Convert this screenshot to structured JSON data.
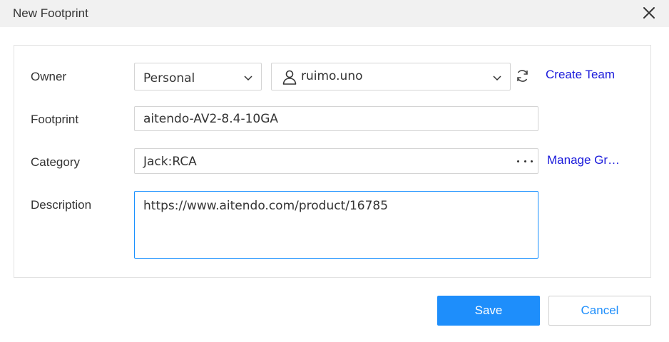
{
  "dialog": {
    "title": "New Footprint"
  },
  "form": {
    "owner": {
      "label": "Owner",
      "type_value": "Personal",
      "user_value": "ruimo.uno",
      "create_team_label": "Create Team"
    },
    "footprint": {
      "label": "Footprint",
      "value": "aitendo-AV2-8.4-10GA"
    },
    "category": {
      "label": "Category",
      "value": "Jack:RCA",
      "manage_groups_label": "Manage Groups"
    },
    "description": {
      "label": "Description",
      "value": "https://www.aitendo.com/product/16785"
    }
  },
  "footer": {
    "save_label": "Save",
    "cancel_label": "Cancel"
  },
  "colors": {
    "primary": "#1e8efb",
    "link": "#1a1adb",
    "title_bar": "#f1f1f1",
    "focus_border": "#1890ff"
  },
  "icons": {
    "close": "close-icon",
    "chevron": "chevron-down-icon",
    "user": "user-icon",
    "refresh": "refresh-icon",
    "more": "more-dots-icon"
  }
}
